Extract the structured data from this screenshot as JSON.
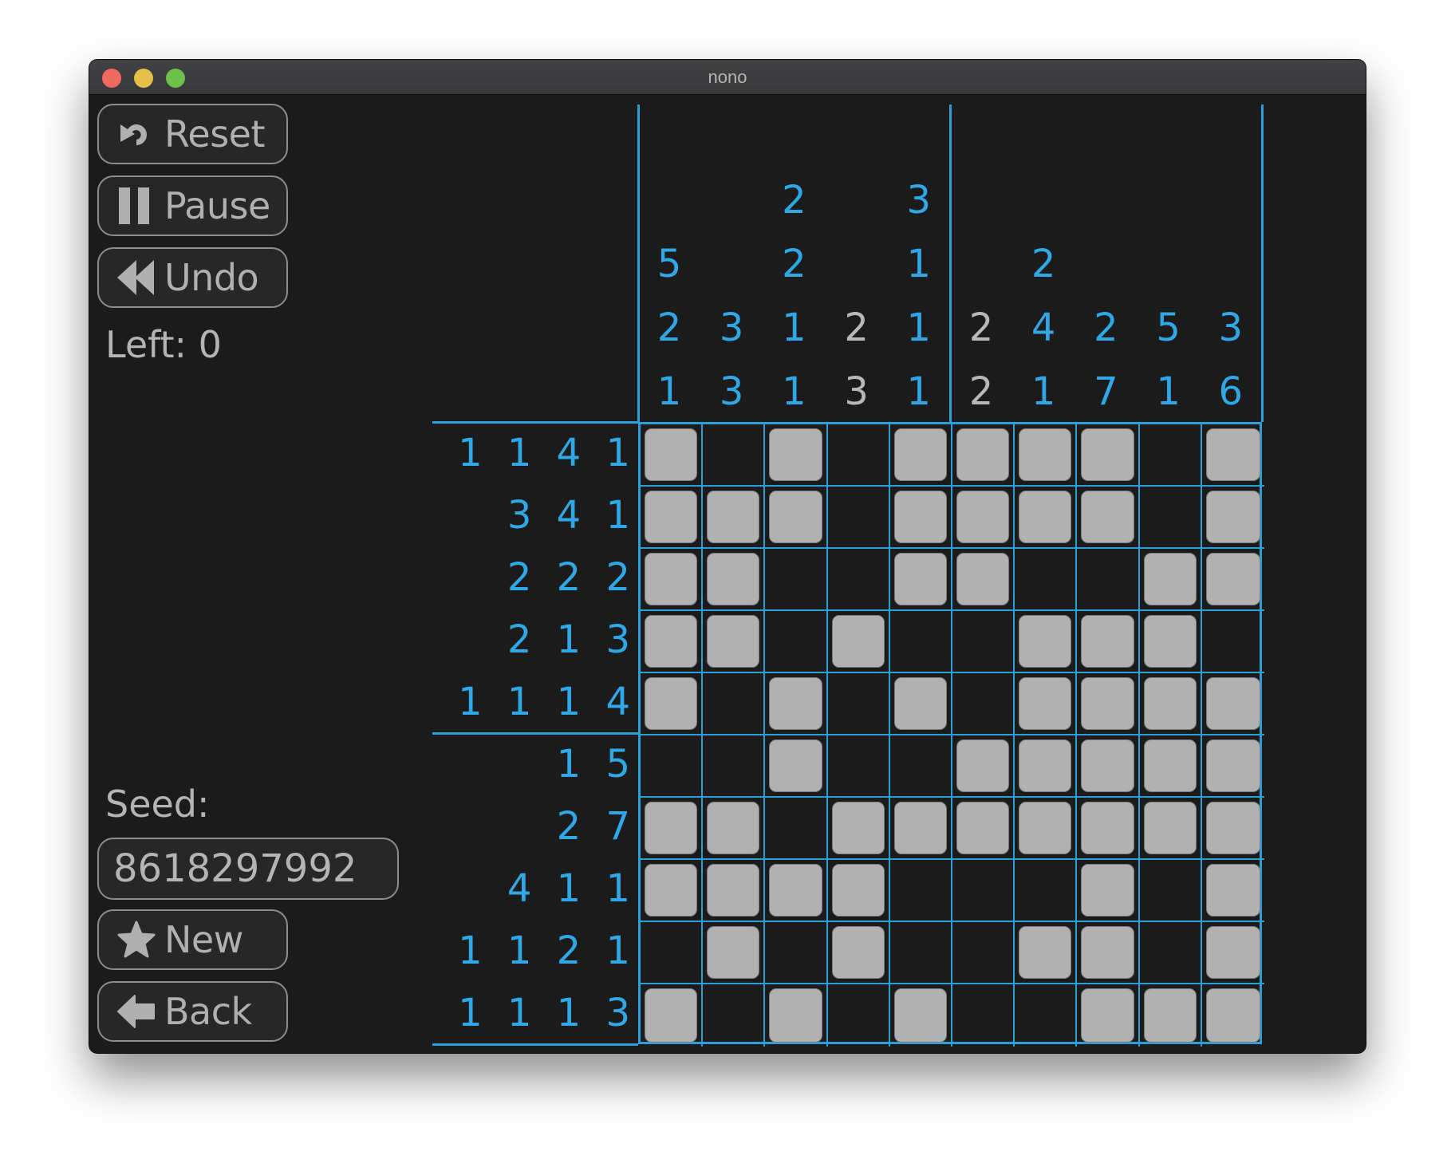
{
  "window": {
    "title": "nono",
    "traffic_lights": [
      "close",
      "minimize",
      "zoom"
    ]
  },
  "colors": {
    "accent_blue": "#2ea8e6",
    "clue_satisfied_grey": "#b8b8b8",
    "cell_fill": "#b1b1b1",
    "background": "#1b1b1b"
  },
  "sidebar": {
    "reset": {
      "label": "Reset",
      "icon": "reset-icon"
    },
    "pause": {
      "label": "Pause",
      "icon": "pause-icon"
    },
    "undo": {
      "label": "Undo",
      "icon": "rewind-icon"
    },
    "left_label": "Left: 0",
    "seed_label": "Seed:",
    "seed_value": "8618297992",
    "new": {
      "label": "New",
      "icon": "star-icon"
    },
    "back": {
      "label": "Back",
      "icon": "arrow-left-icon"
    }
  },
  "puzzle": {
    "size": 10,
    "column_clues": [
      {
        "values": [
          "5",
          "2",
          "1"
        ],
        "status": "active"
      },
      {
        "values": [
          "3",
          "3"
        ],
        "status": "active"
      },
      {
        "values": [
          "2",
          "2",
          "1",
          "1"
        ],
        "status": "active"
      },
      {
        "values": [
          "2",
          "3"
        ],
        "status": "done"
      },
      {
        "values": [
          "3",
          "1",
          "1",
          "1"
        ],
        "status": "active"
      },
      {
        "values": [
          "2",
          "2"
        ],
        "status": "done"
      },
      {
        "values": [
          "2",
          "4",
          "1"
        ],
        "status": "active"
      },
      {
        "values": [
          "2",
          "7"
        ],
        "status": "active"
      },
      {
        "values": [
          "5",
          "1"
        ],
        "status": "active"
      },
      {
        "values": [
          "3",
          "6"
        ],
        "status": "active"
      }
    ],
    "row_clues": [
      {
        "text": "1 1 4 1",
        "status": "active"
      },
      {
        "text": "3 4 1",
        "status": "active"
      },
      {
        "text": "2 2 2",
        "status": "active"
      },
      {
        "text": "2 1 3",
        "status": "active"
      },
      {
        "text": "1 1 1 4",
        "status": "active"
      },
      {
        "text": "1 5",
        "status": "active"
      },
      {
        "text": "2 7",
        "status": "active"
      },
      {
        "text": "4 1 1",
        "status": "active"
      },
      {
        "text": "1 1 2 1",
        "status": "active"
      },
      {
        "text": "1 1 1 3",
        "status": "active"
      }
    ],
    "cells": [
      "1010111101",
      "1110111101",
      "1100110011",
      "1101001110",
      "1010101111",
      "0010011111",
      "1101111111",
      "1111000101",
      "0101001101",
      "1010100111"
    ]
  }
}
